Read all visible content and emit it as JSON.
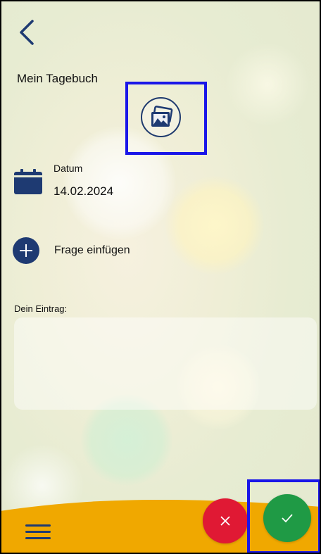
{
  "header": {
    "title": "Mein Tagebuch"
  },
  "date": {
    "label": "Datum",
    "value": "14.02.2024"
  },
  "actions": {
    "add_question_label": "Frage einfügen"
  },
  "entry": {
    "label": "Dein Eintrag:",
    "value": "",
    "placeholder": ""
  },
  "icons": {
    "back": "chevron-left-icon",
    "image": "image-gallery-icon",
    "calendar": "calendar-icon",
    "add": "plus-icon",
    "menu": "menu-icon",
    "cancel": "close-icon",
    "confirm": "checkmark-icon"
  },
  "colors": {
    "primary": "#1e3a72",
    "bottom_bar": "#f0a800",
    "cancel": "#e01934",
    "confirm": "#1f9a45",
    "highlight": "#1a16e8"
  }
}
